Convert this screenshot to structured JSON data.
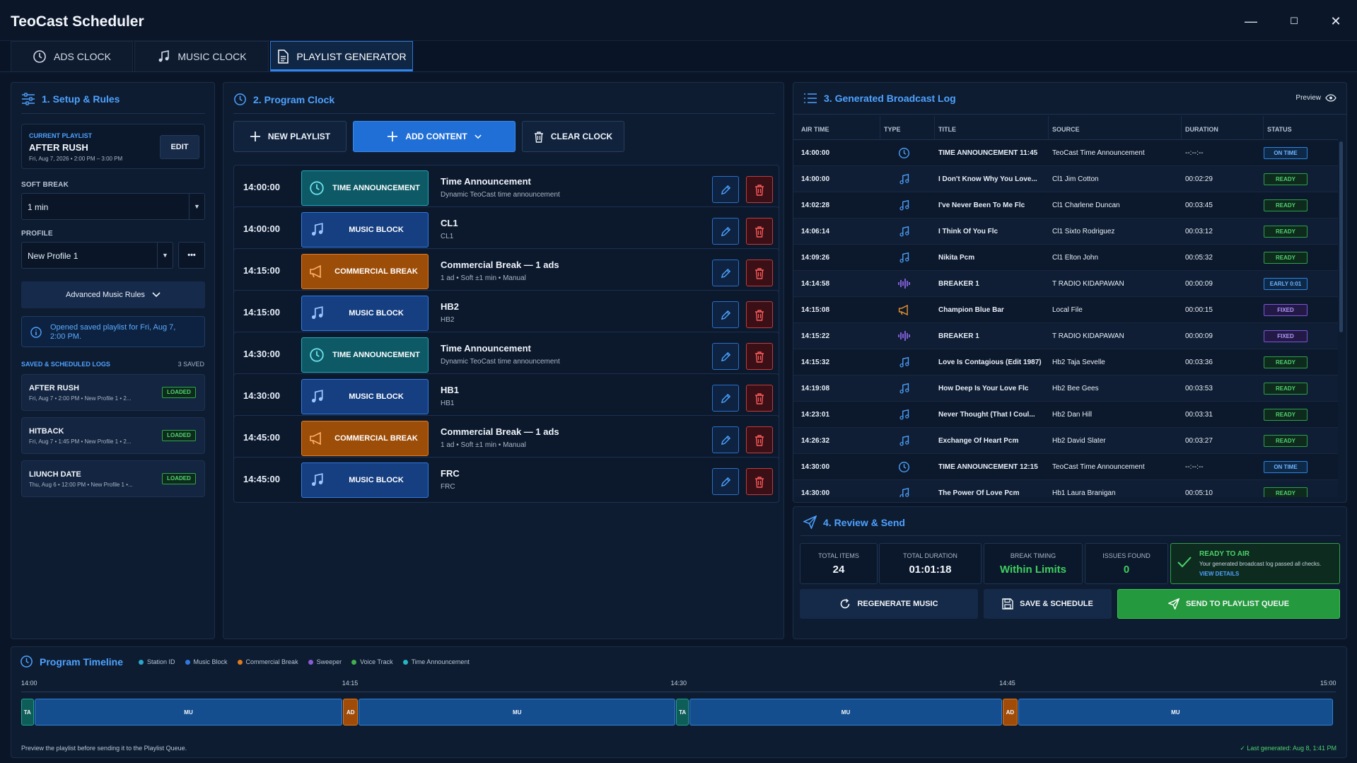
{
  "app": {
    "title": "TeoCast Scheduler"
  },
  "window": {
    "minimize": "—",
    "maximize": "☐",
    "close": "✕"
  },
  "tabs": [
    {
      "label": "ADS CLOCK",
      "icon": "clock-icon"
    },
    {
      "label": "MUSIC CLOCK",
      "icon": "music-note-icon"
    },
    {
      "label": "PLAYLIST GENERATOR",
      "icon": "document-icon",
      "active": true
    }
  ],
  "setup": {
    "title": "1. Setup & Rules",
    "current_playlist_label": "CURRENT PLAYLIST",
    "current_playlist_name": "AFTER RUSH",
    "current_playlist_meta": "Fri, Aug 7, 2026  •  2:00 PM – 3:00 PM",
    "edit_label": "EDIT",
    "soft_break_label": "SOFT BREAK",
    "soft_break_value": "1 min",
    "profile_label": "PROFILE",
    "profile_value": "New Profile 1",
    "more_label": "•••",
    "advanced_label": "Advanced Music Rules",
    "info_text": "Opened saved playlist for Fri, Aug 7, 2:00 PM.",
    "saved_title": "SAVED & SCHEDULED LOGS",
    "saved_count": "3 SAVED",
    "saved_logs": [
      {
        "name": "AFTER RUSH",
        "meta": "Fri, Aug 7  •  2:00 PM  •  New Profile 1  •  2...",
        "badge": "LOADED"
      },
      {
        "name": "HITBACK",
        "meta": "Fri, Aug 7  •  1:45 PM  •  New Profile 1  •  2...",
        "badge": "LOADED"
      },
      {
        "name": "LIUNCH DATE",
        "meta": "Thu, Aug 6  •  12:00 PM  •  New Profile 1  •...",
        "badge": "LOADED"
      }
    ]
  },
  "program_clock": {
    "title": "2. Program Clock",
    "new_playlist": "NEW PLAYLIST",
    "add_content": "ADD CONTENT",
    "clear_clock": "CLEAR CLOCK",
    "rows": [
      {
        "time": "14:00:00",
        "kind": "ta",
        "chip": "TIME ANNOUNCEMENT",
        "title": "Time Announcement",
        "sub": "Dynamic TeoCast time announcement"
      },
      {
        "time": "14:00:00",
        "kind": "mu",
        "chip": "MUSIC BLOCK",
        "title": "CL1",
        "sub": "CL1"
      },
      {
        "time": "14:15:00",
        "kind": "ad",
        "chip": "COMMERCIAL BREAK",
        "title": "Commercial Break — 1 ads",
        "sub": "1 ad  •  Soft ±1 min  •  Manual"
      },
      {
        "time": "14:15:00",
        "kind": "mu",
        "chip": "MUSIC BLOCK",
        "title": "HB2",
        "sub": "HB2"
      },
      {
        "time": "14:30:00",
        "kind": "ta",
        "chip": "TIME ANNOUNCEMENT",
        "title": "Time Announcement",
        "sub": "Dynamic TeoCast time announcement"
      },
      {
        "time": "14:30:00",
        "kind": "mu",
        "chip": "MUSIC BLOCK",
        "title": "HB1",
        "sub": "HB1"
      },
      {
        "time": "14:45:00",
        "kind": "ad",
        "chip": "COMMERCIAL BREAK",
        "title": "Commercial Break — 1 ads",
        "sub": "1 ad  •  Soft ±1 min  •  Manual"
      },
      {
        "time": "14:45:00",
        "kind": "mu",
        "chip": "MUSIC BLOCK",
        "title": "FRC",
        "sub": "FRC"
      }
    ]
  },
  "log": {
    "title": "3. Generated Broadcast Log",
    "preview_label": "Preview",
    "columns": [
      "AIR TIME",
      "TYPE",
      "TITLE",
      "SOURCE",
      "DURATION",
      "STATUS"
    ],
    "rows": [
      {
        "time": "14:00:00",
        "type": "clock",
        "title": "TIME ANNOUNCEMENT 11:45",
        "source": "TeoCast Time Announcement",
        "duration": "--:--:--",
        "status": "ON TIME",
        "status_kind": "ontime"
      },
      {
        "time": "14:00:00",
        "type": "music",
        "title": "I Don't Know Why You Love...",
        "source": "Cl1 Jim Cotton",
        "duration": "00:02:29",
        "status": "READY",
        "status_kind": "ready"
      },
      {
        "time": "14:02:28",
        "type": "music",
        "title": "I've Never Been To Me Flc",
        "source": "Cl1 Charlene Duncan",
        "duration": "00:03:45",
        "status": "READY",
        "status_kind": "ready"
      },
      {
        "time": "14:06:14",
        "type": "music",
        "title": "I Think Of You Flc",
        "source": "Cl1 Sixto Rodriguez",
        "duration": "00:03:12",
        "status": "READY",
        "status_kind": "ready"
      },
      {
        "time": "14:09:26",
        "type": "music",
        "title": "Nikita Pcm",
        "source": "Cl1 Elton John",
        "duration": "00:05:32",
        "status": "READY",
        "status_kind": "ready"
      },
      {
        "time": "14:14:58",
        "type": "wave",
        "title": "BREAKER 1",
        "source": "T RADIO KIDAPAWAN",
        "duration": "00:00:09",
        "status": "EARLY 0:01",
        "status_kind": "early"
      },
      {
        "time": "14:15:08",
        "type": "megaphone",
        "title": "Champion Blue Bar",
        "source": "Local File",
        "duration": "00:00:15",
        "status": "FIXED",
        "status_kind": "fixed"
      },
      {
        "time": "14:15:22",
        "type": "wave",
        "title": "BREAKER 1",
        "source": "T RADIO KIDAPAWAN",
        "duration": "00:00:09",
        "status": "FIXED",
        "status_kind": "fixed"
      },
      {
        "time": "14:15:32",
        "type": "music",
        "title": "Love Is Contagious (Edit 1987)",
        "source": "Hb2 Taja Sevelle",
        "duration": "00:03:36",
        "status": "READY",
        "status_kind": "ready"
      },
      {
        "time": "14:19:08",
        "type": "music",
        "title": "How Deep Is Your Love Flc",
        "source": "Hb2 Bee Gees",
        "duration": "00:03:53",
        "status": "READY",
        "status_kind": "ready"
      },
      {
        "time": "14:23:01",
        "type": "music",
        "title": "Never Thought (That I Coul...",
        "source": "Hb2 Dan Hill",
        "duration": "00:03:31",
        "status": "READY",
        "status_kind": "ready"
      },
      {
        "time": "14:26:32",
        "type": "music",
        "title": "Exchange Of Heart Pcm",
        "source": "Hb2 David Slater",
        "duration": "00:03:27",
        "status": "READY",
        "status_kind": "ready"
      },
      {
        "time": "14:30:00",
        "type": "clock",
        "title": "TIME ANNOUNCEMENT 12:15",
        "source": "TeoCast Time Announcement",
        "duration": "--:--:--",
        "status": "ON TIME",
        "status_kind": "ontime"
      },
      {
        "time": "14:30:00",
        "type": "music",
        "title": "The Power Of Love Pcm",
        "source": "Hb1 Laura Branigan",
        "duration": "00:05:10",
        "status": "READY",
        "status_kind": "ready"
      }
    ]
  },
  "review": {
    "title": "4. Review & Send",
    "total_items_label": "TOTAL ITEMS",
    "total_items": "24",
    "total_duration_label": "TOTAL DURATION",
    "total_duration": "01:01:18",
    "break_timing_label": "BREAK TIMING",
    "break_timing": "Within Limits",
    "issues_label": "ISSUES FOUND",
    "issues": "0",
    "ready_title": "READY TO AIR",
    "ready_text": "Your generated broadcast log passed all checks.",
    "view_details": "VIEW DETAILS",
    "regenerate": "REGENERATE MUSIC",
    "save": "SAVE & SCHEDULE",
    "send": "SEND TO PLAYLIST QUEUE"
  },
  "timeline": {
    "title": "Program Timeline",
    "legend": [
      {
        "label": "Station ID",
        "color": "#2aa7c9"
      },
      {
        "label": "Music Block",
        "color": "#2f7ae0"
      },
      {
        "label": "Commercial Break",
        "color": "#e27a1e"
      },
      {
        "label": "Sweeper",
        "color": "#8a5bd6"
      },
      {
        "label": "Voice Track",
        "color": "#3fb24f"
      },
      {
        "label": "Time Announcement",
        "color": "#25b6c4"
      }
    ],
    "ticks": [
      "14:00",
      "14:15",
      "14:30",
      "14:45",
      "15:00"
    ],
    "segments": [
      {
        "label": "TA",
        "kind": "ta",
        "start": 0,
        "end": 0.6
      },
      {
        "label": "MU",
        "kind": "mu",
        "start": 0.6,
        "end": 14.7
      },
      {
        "label": "AD",
        "kind": "ad",
        "start": 14.7,
        "end": 15.4
      },
      {
        "label": "MU",
        "kind": "mu",
        "start": 15.4,
        "end": 29.9
      },
      {
        "label": "TA",
        "kind": "ta",
        "start": 29.9,
        "end": 30.5
      },
      {
        "label": "MU",
        "kind": "mu",
        "start": 30.5,
        "end": 44.8
      },
      {
        "label": "AD",
        "kind": "ad",
        "start": 44.8,
        "end": 45.5
      },
      {
        "label": "MU",
        "kind": "mu",
        "start": 45.5,
        "end": 59.9
      }
    ],
    "footer_left": "Preview the playlist before sending it to the Playlist Queue.",
    "footer_right": "✓  Last generated: Aug 8, 1:41 PM"
  }
}
